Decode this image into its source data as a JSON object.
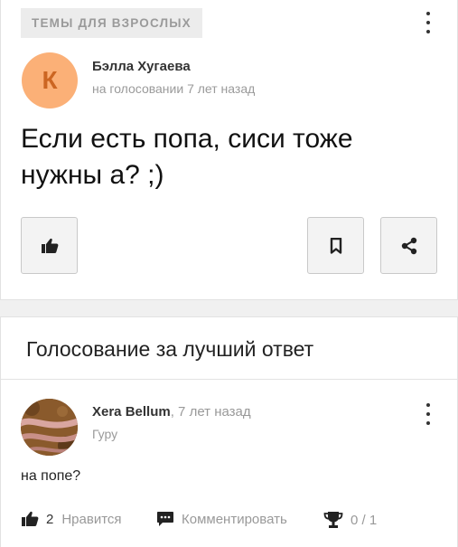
{
  "question_card": {
    "category_tag": "ТЕМЫ ДЛЯ ВЗРОСЛЫХ",
    "avatar_letter": "К",
    "author": "Бэлла Хугаева",
    "meta": "на голосовании 7 лет назад",
    "question": "Если есть попа, сиси тоже нужны а? ;)",
    "buttons": [
      "thumbs-up-icon",
      "bookmark-icon",
      "share-icon"
    ]
  },
  "vote_section": {
    "title": "Голосование за лучший ответ"
  },
  "answer": {
    "author": "Xera Bellum",
    "time": ", 7 лет назад",
    "rank": "Гуру",
    "text": "на попе?",
    "likes_count": "2",
    "like_label": "Нравится",
    "comment_label": "Комментировать",
    "votes": "0 / 1"
  },
  "colors": {
    "avatar_bg": "#fbb077",
    "avatar_letter": "#cc6622",
    "tag_bg": "#ececec",
    "muted_text": "#9a9a9a"
  }
}
